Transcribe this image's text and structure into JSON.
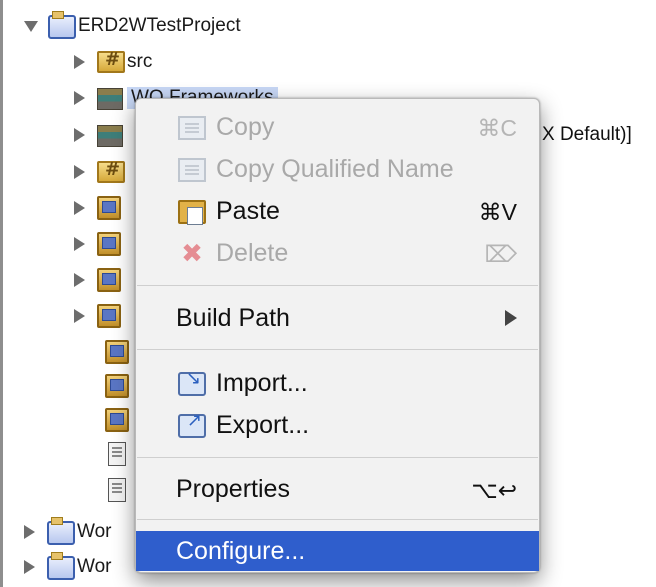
{
  "tree": {
    "project": "ERD2WTestProject",
    "src": "src",
    "wo_frameworks_partial": "WO Frameworks",
    "jre_partial": "X Default)]",
    "bottom_items_partial": [
      "Wor",
      "Wor"
    ]
  },
  "menu": {
    "copy": {
      "label": "Copy",
      "shortcut": "⌘C",
      "enabled": false,
      "icon": "copy-icon"
    },
    "copy_qualified": {
      "label": "Copy Qualified Name",
      "enabled": false,
      "icon": "copy-qualified-icon"
    },
    "paste": {
      "label": "Paste",
      "shortcut": "⌘V",
      "enabled": true,
      "icon": "paste-icon"
    },
    "delete": {
      "label": "Delete",
      "shortcut": "⌦",
      "enabled": false,
      "icon": "delete-icon"
    },
    "build_path": {
      "label": "Build Path",
      "submenu": true
    },
    "import": {
      "label": "Import...",
      "icon": "import-icon"
    },
    "export": {
      "label": "Export...",
      "icon": "export-icon"
    },
    "properties": {
      "label": "Properties",
      "shortcut": "⌥↩"
    },
    "configure": {
      "label": "Configure...",
      "highlighted": true
    }
  },
  "colors": {
    "highlight": "#2f5ecc",
    "selection": "#c7d7f5",
    "disabled_text": "#a9a9a9"
  }
}
